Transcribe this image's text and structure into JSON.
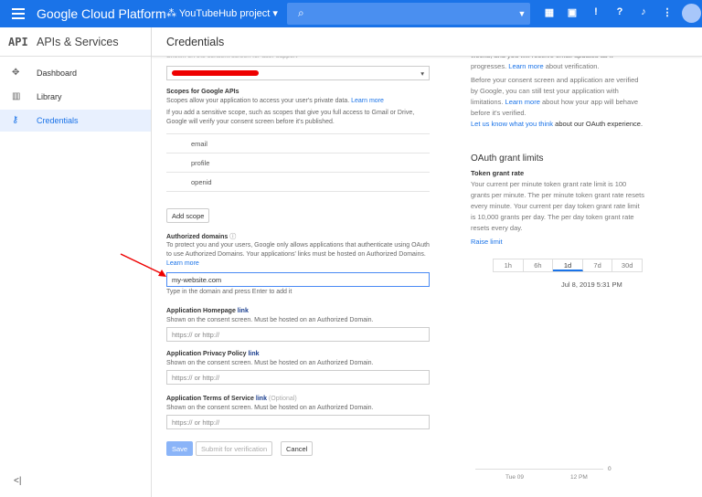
{
  "topbar": {
    "brand": "Google Cloud Platform",
    "project": "YouTubeHub project"
  },
  "sidebar": {
    "logo": "API",
    "title": "APIs & Services",
    "items": [
      {
        "label": "Dashboard",
        "icon": "dashboard-icon"
      },
      {
        "label": "Library",
        "icon": "library-icon"
      },
      {
        "label": "Credentials",
        "icon": "key-icon"
      }
    ],
    "collapse": "<|"
  },
  "header": {
    "title": "Credentials"
  },
  "form": {
    "support_hint": "Shown on the consent screen for user support",
    "scopes_title": "Scopes for Google APIs",
    "scopes_desc": "Scopes allow your application to access your user's private data.",
    "learn_more": "Learn more",
    "scopes_note": "If you add a sensitive scope, such as scopes that give you full access to Gmail or Drive, Google will verify your consent screen before it's published.",
    "scopes": [
      "email",
      "profile",
      "openid"
    ],
    "add_scope": "Add scope",
    "domains_title": "Authorized domains",
    "domains_desc": "To protect you and your users, Google only allows applications that authenticate using OAuth to use Authorized Domains. Your applications' links must be hosted on Authorized Domains.",
    "domain_value": "my-website.com",
    "domain_hint": "Type in the domain and press Enter to add it",
    "homepage_title": "Application Homepage",
    "privacy_title": "Application Privacy Policy",
    "tos_title": "Application Terms of Service",
    "link_word": "link",
    "optional": "(Optional)",
    "link_hint": "Shown on the consent screen. Must be hosted on an Authorized Domain.",
    "url_placeholder": "https:// or http://",
    "save": "Save",
    "submit": "Submit for verification",
    "cancel": "Cancel"
  },
  "right": {
    "p0a": "weeks, and you will receive email updates as it progresses.",
    "p0link": "Learn more",
    "p0b": "about verification.",
    "p1a": "Before your consent screen and application are verified by Google, you can still test your application with limitations.",
    "p1link": "Learn more",
    "p1b": "about how your app will behave before it's verified.",
    "p2link": "Let us know what you think",
    "p2b": "about our OAuth experience.",
    "grant_title": "OAuth grant limits",
    "rate_title": "Token grant rate",
    "rate_desc": "Your current per minute token grant rate limit is 100 grants per minute. The per minute token grant rate resets every minute. Your current per day token grant rate limit is 10,000 grants per day. The per day token grant rate resets every day.",
    "raise": "Raise limit",
    "ranges": [
      "1h",
      "6h",
      "1d",
      "7d",
      "30d"
    ],
    "selected_range": "1d",
    "timestamp": "Jul 8, 2019 5:31 PM",
    "chart": {
      "x_ticks": [
        "Tue 09",
        "12 PM"
      ],
      "y_tick": "0"
    }
  }
}
